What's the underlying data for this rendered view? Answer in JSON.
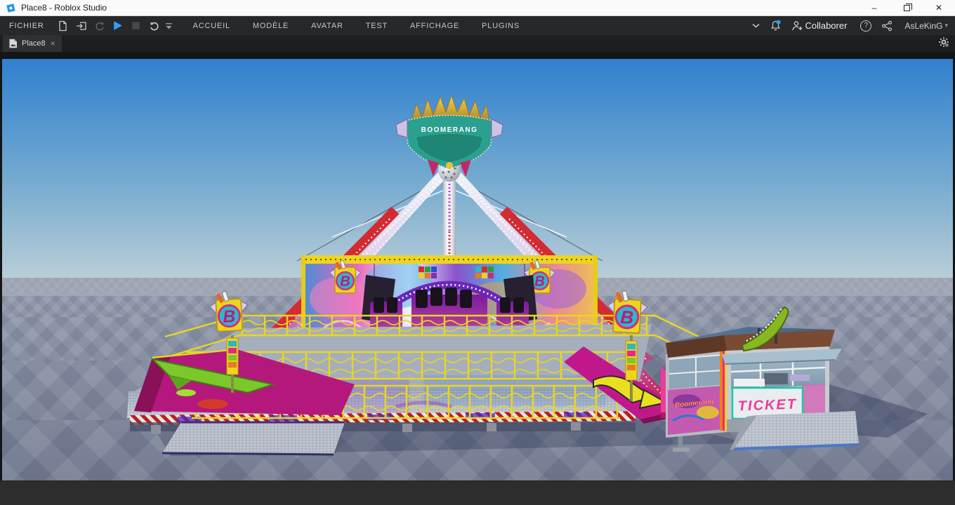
{
  "window": {
    "title": "Place8 - Roblox Studio"
  },
  "menubar": {
    "file_menu": "FICHIER",
    "items": [
      {
        "label": "ACCUEIL"
      },
      {
        "label": "MODÈLE"
      },
      {
        "label": "AVATAR"
      },
      {
        "label": "TEST"
      },
      {
        "label": "AFFICHAGE"
      },
      {
        "label": "PLUGINS"
      }
    ],
    "collaborate_label": "Collaborer",
    "username": "AsLeKinG"
  },
  "tabbar": {
    "active_tab": "Place8"
  },
  "icons": {
    "help": "?",
    "minimize_window": "–",
    "close_window": "✕",
    "tab_close": "×",
    "caret_down": "▾"
  },
  "colors": {
    "play_accent": "#2f9ff6",
    "notification_dot": "#2f9ff6",
    "sky_top": "#2f7ecd",
    "sky_horizon": "#b9cdd8",
    "ground": "#8a93a7",
    "railing_yellow": "#e8d621",
    "support_red": "#d42a33",
    "ramp_magenta": "#bb1781",
    "crest_teal": "#2ba08e",
    "ticket_pink": "#f0389c"
  },
  "scene": {
    "crest_text": "BOOMERANG",
    "ticket_sign": "TICKET",
    "booth_graffiti": "Boomerang",
    "b_sign_letter": "B"
  }
}
